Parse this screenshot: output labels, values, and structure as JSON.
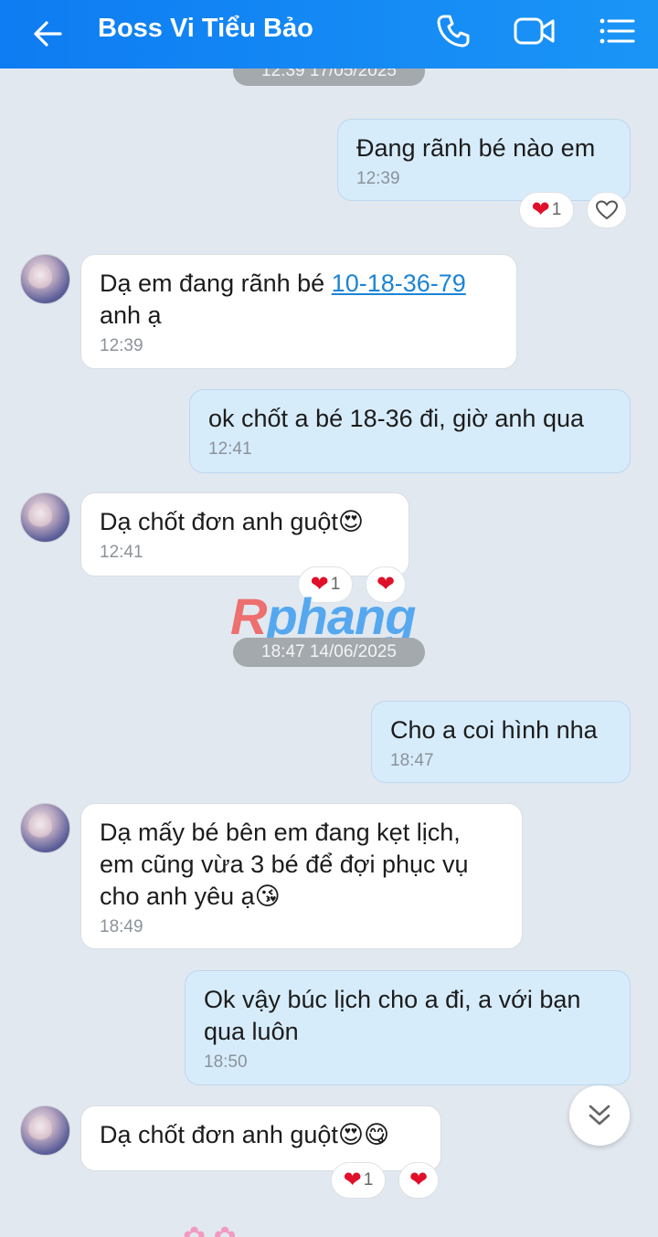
{
  "header": {
    "title": "Boss Vi Tiểu Bảo",
    "colors": {
      "background": "#1a8cf4",
      "text": "#ffffff"
    },
    "icons": [
      "back-arrow-icon",
      "phone-icon",
      "video-call-icon",
      "menu-list-icon"
    ]
  },
  "dates": [
    {
      "label": "12:39 17/05/2025"
    },
    {
      "label": "18:47 14/06/2025"
    }
  ],
  "watermark": {
    "r": "R",
    "rest": "phang"
  },
  "messages": [
    {
      "dir": "out",
      "text": "Đang rãnh bé nào em",
      "time": "12:39",
      "reaction_count": "1"
    },
    {
      "dir": "in",
      "text_before": "Dạ em đang rãnh bé ",
      "link": "10-18-36-79",
      "text_after": "anh ạ",
      "time": "12:39"
    },
    {
      "dir": "out",
      "text": "ok chốt a bé 18-36 đi, giờ anh qua",
      "time": "12:41"
    },
    {
      "dir": "in",
      "text": "Dạ chốt đơn anh guột😍",
      "time": "12:41",
      "reaction_count": "1"
    },
    {
      "dir": "out",
      "text": "Cho a coi hình nha",
      "time": "18:47"
    },
    {
      "dir": "in",
      "text": "Dạ mấy bé bên em đang kẹt lịch,\nem cũng vừa 3 bé để đợi phục vụ\ncho anh yêu ạ😘",
      "time": "18:49"
    },
    {
      "dir": "out",
      "text": "Ok vậy búc lịch cho a đi, a với bạn\nqua luôn",
      "time": "18:50"
    },
    {
      "dir": "in",
      "text": "Dạ chốt đơn anh guột😍😋",
      "time": "",
      "reaction_count": "1"
    }
  ],
  "colors": {
    "chat_bg": "#e2e8ef",
    "out_bubble": "#d7ecfb",
    "in_bubble": "#ffffff",
    "heart": "#e0102a"
  }
}
